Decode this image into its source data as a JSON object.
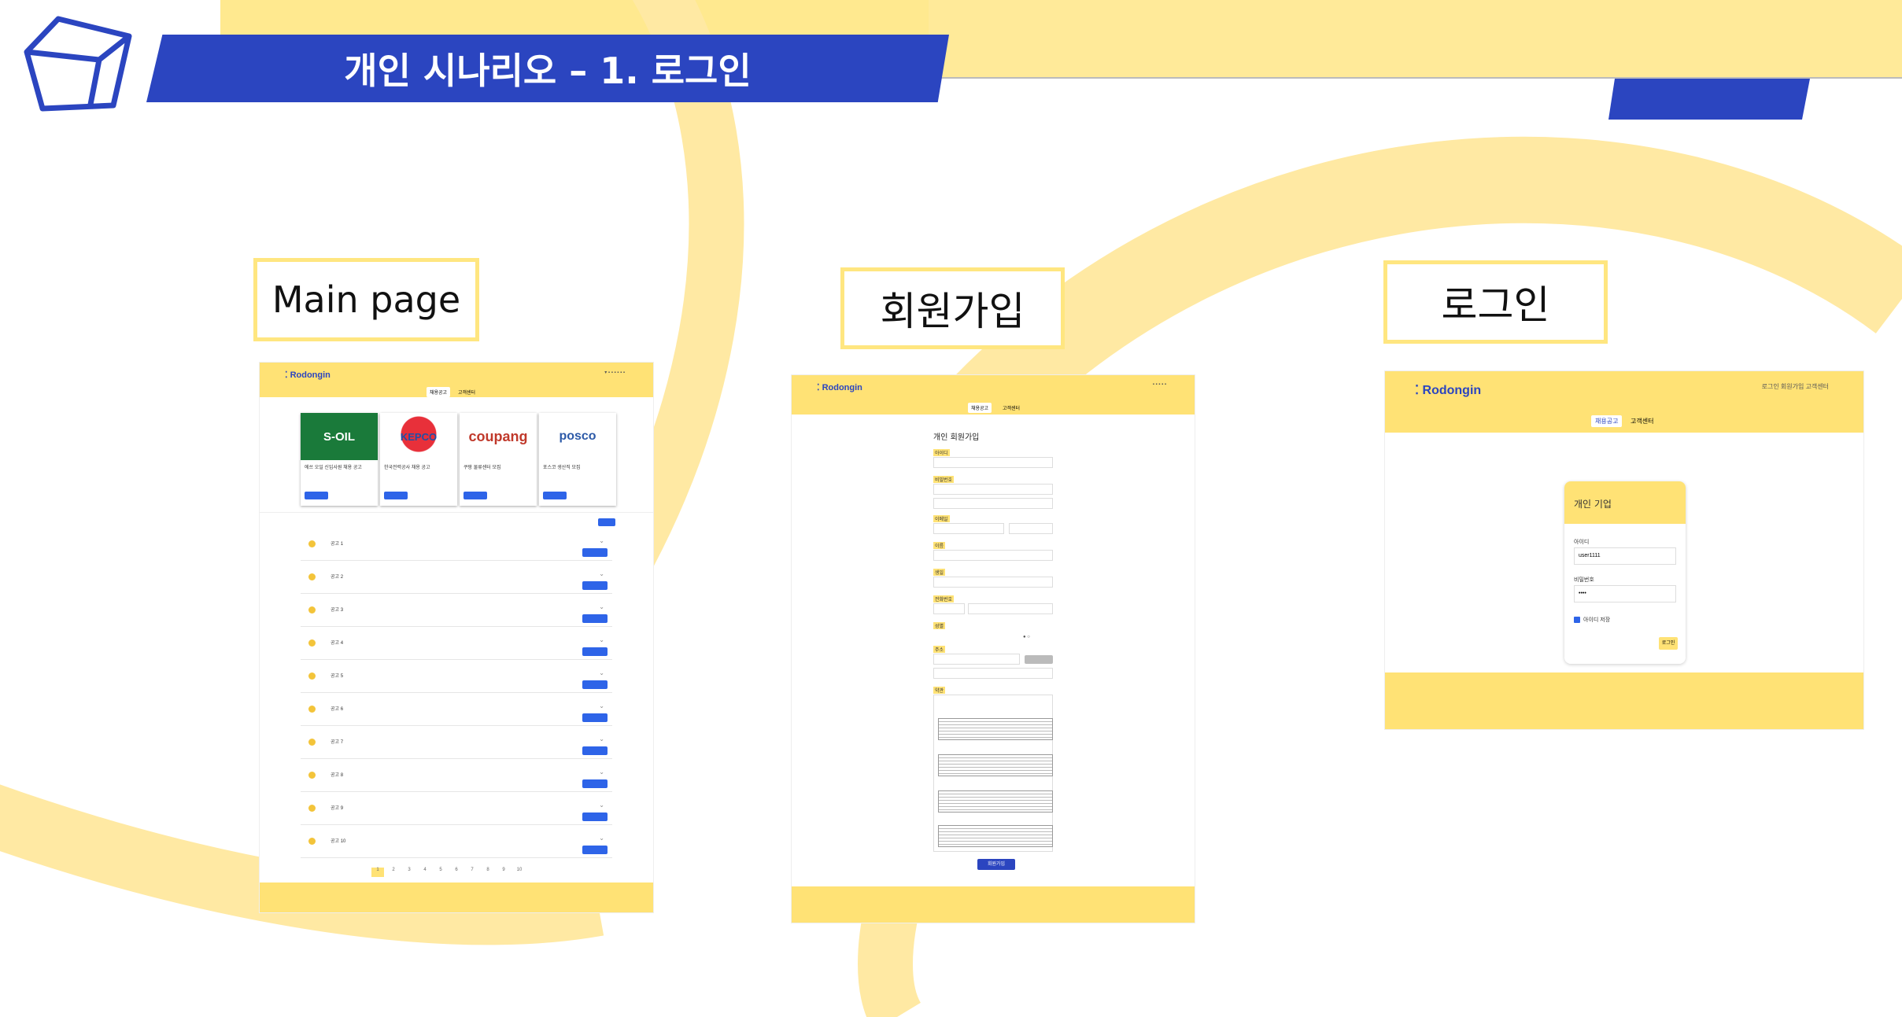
{
  "slide": {
    "title": "개인 시나리오 – 1. 로그인",
    "accent_color": "#2B45C0",
    "decor_color": "#FFE680",
    "icon": "cube-icon"
  },
  "labels": {
    "main": "Main page",
    "signup": "회원가입",
    "login": "로그인"
  },
  "brand": "Rodongin",
  "main_page": {
    "nav_tabs": [
      "채용공고",
      "고객센터"
    ],
    "cards": [
      {
        "logo": "S-OIL",
        "title": "에쓰 오일 신입사원 채용 공고",
        "bg": "#1a7a3a",
        "fg": "#ffffff"
      },
      {
        "logo": "KEPCO",
        "title": "한국전력공사 채용 공고",
        "bg": "#ffffff",
        "fg": "#1f4fa8"
      },
      {
        "logo": "coupang",
        "title": "쿠팡 물류센터 모집",
        "bg": "#ffffff",
        "fg": "#c0392b"
      },
      {
        "logo": "posco",
        "title": "포스코 생산직 모집",
        "bg": "#ffffff",
        "fg": "#2d5aa8"
      }
    ],
    "jobs": [
      "공고 1",
      "공고 2",
      "공고 3",
      "공고 4",
      "공고 5",
      "공고 6",
      "공고 7",
      "공고 8",
      "공고 9",
      "공고 10"
    ],
    "pages": [
      "1",
      "2",
      "3",
      "4",
      "5",
      "6",
      "7",
      "8",
      "9",
      "10"
    ]
  },
  "signup_page": {
    "tabs": [
      "채용공고",
      "고객센터"
    ],
    "form_title": "개인 회원가입",
    "fields": [
      "아이디",
      "비밀번호",
      "이메일",
      "이름",
      "생일",
      "전화번호",
      "성별",
      "주소",
      "약관"
    ],
    "submit": "회원가입"
  },
  "login_page": {
    "header_links": "로그인 회원가입 고객센터",
    "tabs": [
      "채용공고",
      "고객센터"
    ],
    "card_title": "개인 기업",
    "id_label": "아이디",
    "id_value": "user1111",
    "pw_label": "비밀번호",
    "pw_value": "••••",
    "remember": "아이디 저장",
    "submit": "로그인"
  }
}
